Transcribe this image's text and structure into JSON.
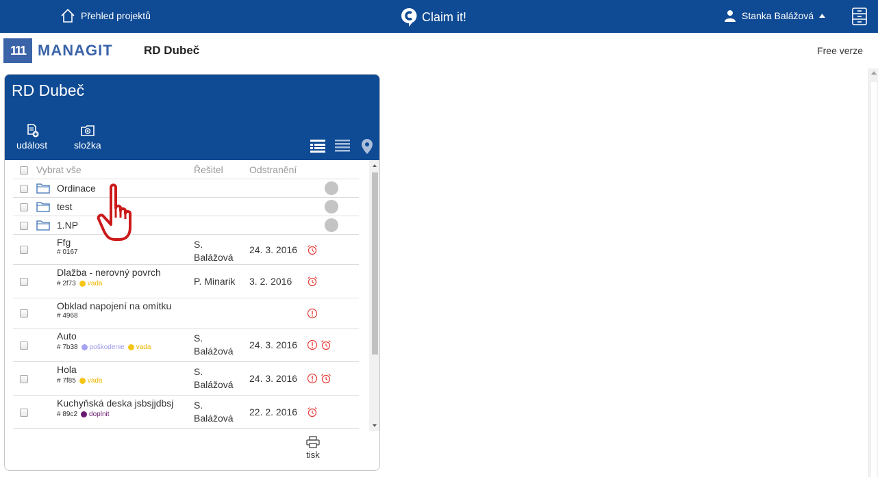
{
  "topbar": {
    "home_label": "Přehled projektů",
    "brand": "Claim it!",
    "user_name": "Stanka Balážová",
    "menu_icon": "cabinet-icon"
  },
  "subbar": {
    "logo_mark": "111",
    "logo_text": "MANAGIT",
    "project_title": "RD Dubeč",
    "plan": "Free verze"
  },
  "panel": {
    "title": "RD Dubeč",
    "actions": [
      {
        "label": "událost",
        "icon": "new-document-icon"
      },
      {
        "label": "složka",
        "icon": "new-folder-icon"
      }
    ],
    "views": [
      "detail-list-view-icon",
      "compact-list-view-icon",
      "map-pin-icon"
    ]
  },
  "table": {
    "headers": {
      "select_all": "Vybrat vše",
      "resitel": "Řešitel",
      "odstraneni": "Odstranění"
    },
    "folders": [
      "Ordinace",
      "test",
      "1.NP"
    ],
    "items": [
      {
        "name": "Ffg",
        "id": "# 0167",
        "tags": [],
        "resitel_1": "S.",
        "resitel_2": "Balážová",
        "date": "24. 3. 2016",
        "icons": [
          "alarm-clock-icon"
        ]
      },
      {
        "name": "Dlažba - nerovný povrch",
        "id": "# 2f73",
        "tags": [
          {
            "label": "vada",
            "color": "#f5c518"
          }
        ],
        "resitel_1": "P. Minarik",
        "resitel_2": "",
        "date": "3. 2. 2016",
        "icons": [
          "alarm-clock-icon"
        ]
      },
      {
        "name": "Obklad napojení na omítku",
        "id": "# 4968",
        "tags": [],
        "resitel_1": "",
        "resitel_2": "",
        "date": "",
        "icons": [
          "warning-circle-icon"
        ]
      },
      {
        "name": "Auto",
        "id": "# 7b38",
        "tags": [
          {
            "label": "poškodenie",
            "color": "#a6a4f0"
          },
          {
            "label": "vada",
            "color": "#f5c518"
          }
        ],
        "resitel_1": "S.",
        "resitel_2": "Balážová",
        "date": "24. 3. 2016",
        "icons": [
          "warning-circle-icon",
          "alarm-clock-icon"
        ]
      },
      {
        "name": "Hola",
        "id": "# 7f85",
        "tags": [
          {
            "label": "vada",
            "color": "#f5c518"
          }
        ],
        "resitel_1": "S.",
        "resitel_2": "Balážová",
        "date": "24. 3. 2016",
        "icons": [
          "warning-circle-icon",
          "alarm-clock-icon"
        ]
      },
      {
        "name": "Kuchyňská deska jsbsjjdbsj",
        "id": "# 89c2",
        "tags": [
          {
            "label": "doplnit",
            "color": "#6a1a70"
          }
        ],
        "resitel_1": "S.",
        "resitel_2": "Balážová",
        "date": "22. 2. 2016",
        "icons": [
          "alarm-clock-icon"
        ]
      }
    ]
  },
  "footer": {
    "print_label": "tisk"
  },
  "colors": {
    "primary": "#0f4a94",
    "alert": "#e53935",
    "vada": "#f5c518",
    "poskodenie": "#a6a4f0",
    "doplnit": "#6a1a70"
  }
}
